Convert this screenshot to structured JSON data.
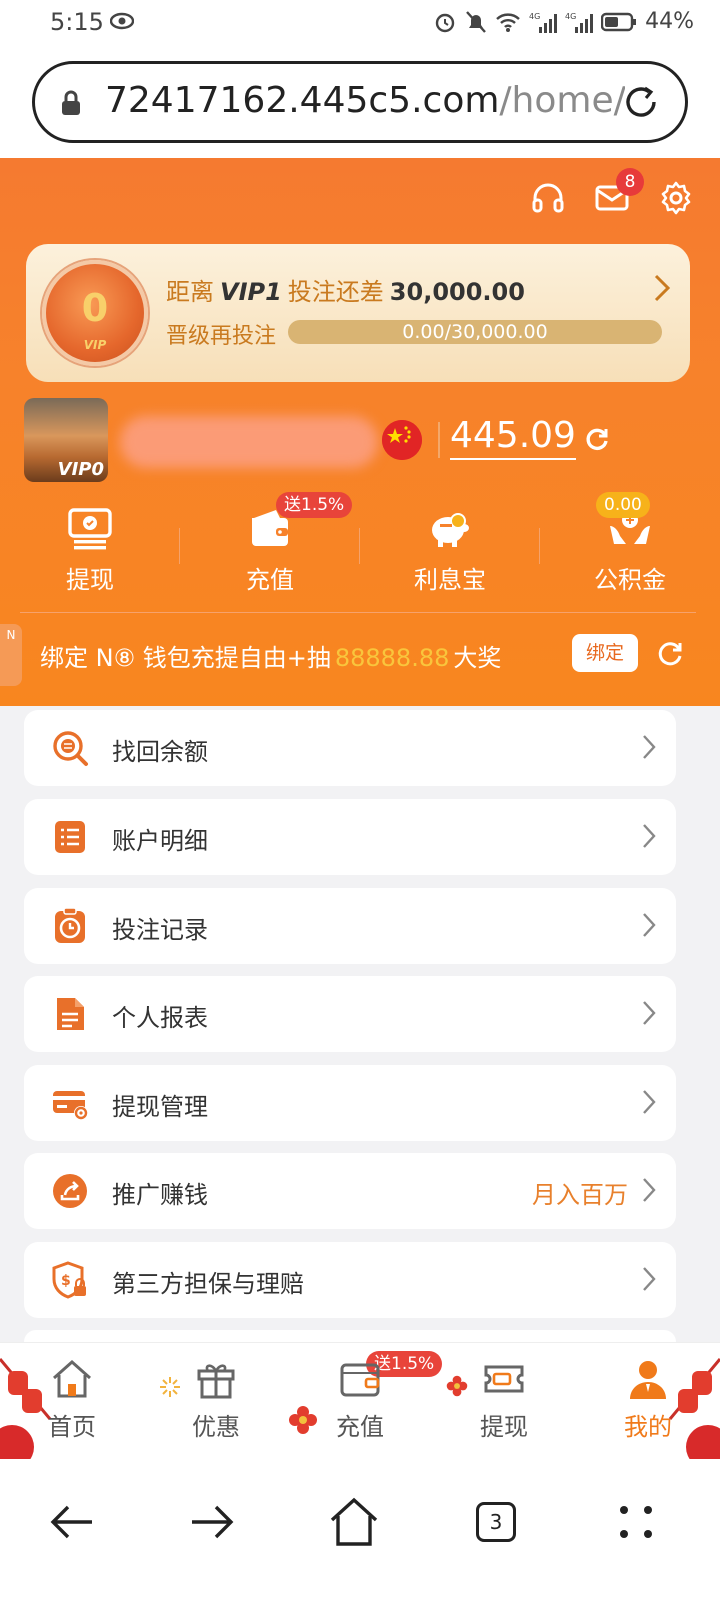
{
  "status": {
    "time": "5:15",
    "battery": "44%",
    "net1": "4G",
    "net2": "4G"
  },
  "browser": {
    "url_host": "72417162.445c5.com",
    "url_path": "/home/r",
    "tab_count": "3"
  },
  "header": {
    "message_badge": "8",
    "vip": {
      "medal_level": "0",
      "medal_text": "VIP",
      "line_prefix": "距离",
      "next_level": "VIP1",
      "line_middle": "投注还差",
      "amount_needed": "30,000.00",
      "upgrade_label": "晋级再投注",
      "progress_text": "0.00/30,000.00",
      "progress_fraction": 0
    },
    "profile": {
      "avatar_badge": "VIP0",
      "balance": "445.09"
    },
    "actions": [
      {
        "label": "提现",
        "icon": "withdraw-icon"
      },
      {
        "label": "充值",
        "icon": "wallet-icon",
        "tag": "送1.5%"
      },
      {
        "label": "利息宝",
        "icon": "piggy-bank-icon"
      },
      {
        "label": "公积金",
        "icon": "hands-coin-icon",
        "tag": "0.00"
      }
    ],
    "promo": {
      "side_text": "N",
      "text_prefix": "绑定 N⑧ 钱包充提自由+抽",
      "amount": "88888.88",
      "text_suffix": "大奖",
      "bind_button": "绑定"
    }
  },
  "menu": [
    {
      "label": "找回余额",
      "icon": "search-coin-icon"
    },
    {
      "label": "账户明细",
      "icon": "list-doc-icon"
    },
    {
      "label": "投注记录",
      "icon": "clock-record-icon"
    },
    {
      "label": "个人报表",
      "icon": "report-doc-icon"
    },
    {
      "label": "提现管理",
      "icon": "card-gear-icon"
    },
    {
      "label": "推广赚钱",
      "icon": "share-icon",
      "extra": "月入百万"
    },
    {
      "label": "第三方担保与理赔",
      "icon": "shield-dollar-icon"
    }
  ],
  "tabbar": [
    {
      "label": "首页",
      "icon": "home-icon"
    },
    {
      "label": "优惠",
      "icon": "gift-icon"
    },
    {
      "label": "充值",
      "icon": "wallet-icon",
      "tag": "送1.5%"
    },
    {
      "label": "提现",
      "icon": "ticket-icon"
    },
    {
      "label": "我的",
      "icon": "person-icon",
      "active": true
    }
  ],
  "colors": {
    "primary_orange": "#f7822b",
    "accent_gold": "#f9c53c",
    "tag_red": "#e8443a"
  }
}
